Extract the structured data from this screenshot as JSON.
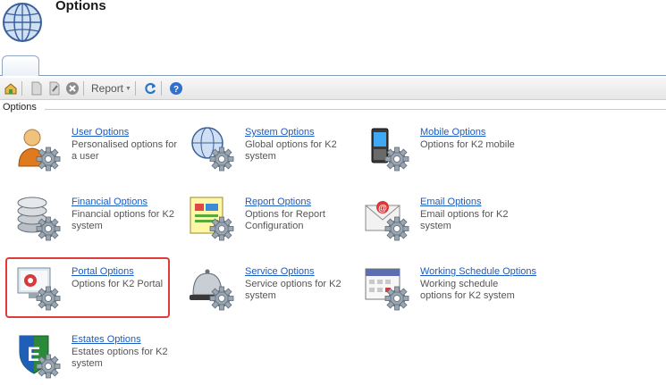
{
  "header": {
    "title": "Options",
    "icon": "globe-icon"
  },
  "toolbar": {
    "report_label": "Report",
    "icons": [
      "home-icon",
      "new-document-icon",
      "edit-icon",
      "delete-icon",
      "refresh-icon",
      "help-icon"
    ]
  },
  "group": {
    "label": "Options"
  },
  "items": [
    {
      "link": "User Options",
      "desc": "Personalised options for a user",
      "icon": "user-icon"
    },
    {
      "link": "System Options",
      "desc": "Global options for K2 system",
      "icon": "globe-gear-icon"
    },
    {
      "link": "Mobile Options",
      "desc": "Options for K2 mobile",
      "icon": "mobile-icon"
    },
    {
      "link": "Financial Options",
      "desc": "Financial options for K2 system",
      "icon": "coins-icon"
    },
    {
      "link": "Report Options",
      "desc": "Options for Report Configuration",
      "icon": "report-icon"
    },
    {
      "link": "Email Options",
      "desc": "Email options for K2 system",
      "icon": "email-icon"
    },
    {
      "link": "Portal Options",
      "desc": "Options for K2 Portal",
      "icon": "portal-icon"
    },
    {
      "link": "Service Options",
      "desc": "Service options for K2 system",
      "icon": "service-bell-icon"
    },
    {
      "link": "Working Schedule Options",
      "desc": "Working schedule options for K2 system",
      "icon": "calendar-icon"
    },
    {
      "link": "Estates Options",
      "desc": "Estates options for K2 system",
      "icon": "estates-shield-icon"
    }
  ],
  "colors": {
    "link": "#1a5cc4",
    "highlight": "#e03b3b",
    "accent": "#7f9db9"
  }
}
